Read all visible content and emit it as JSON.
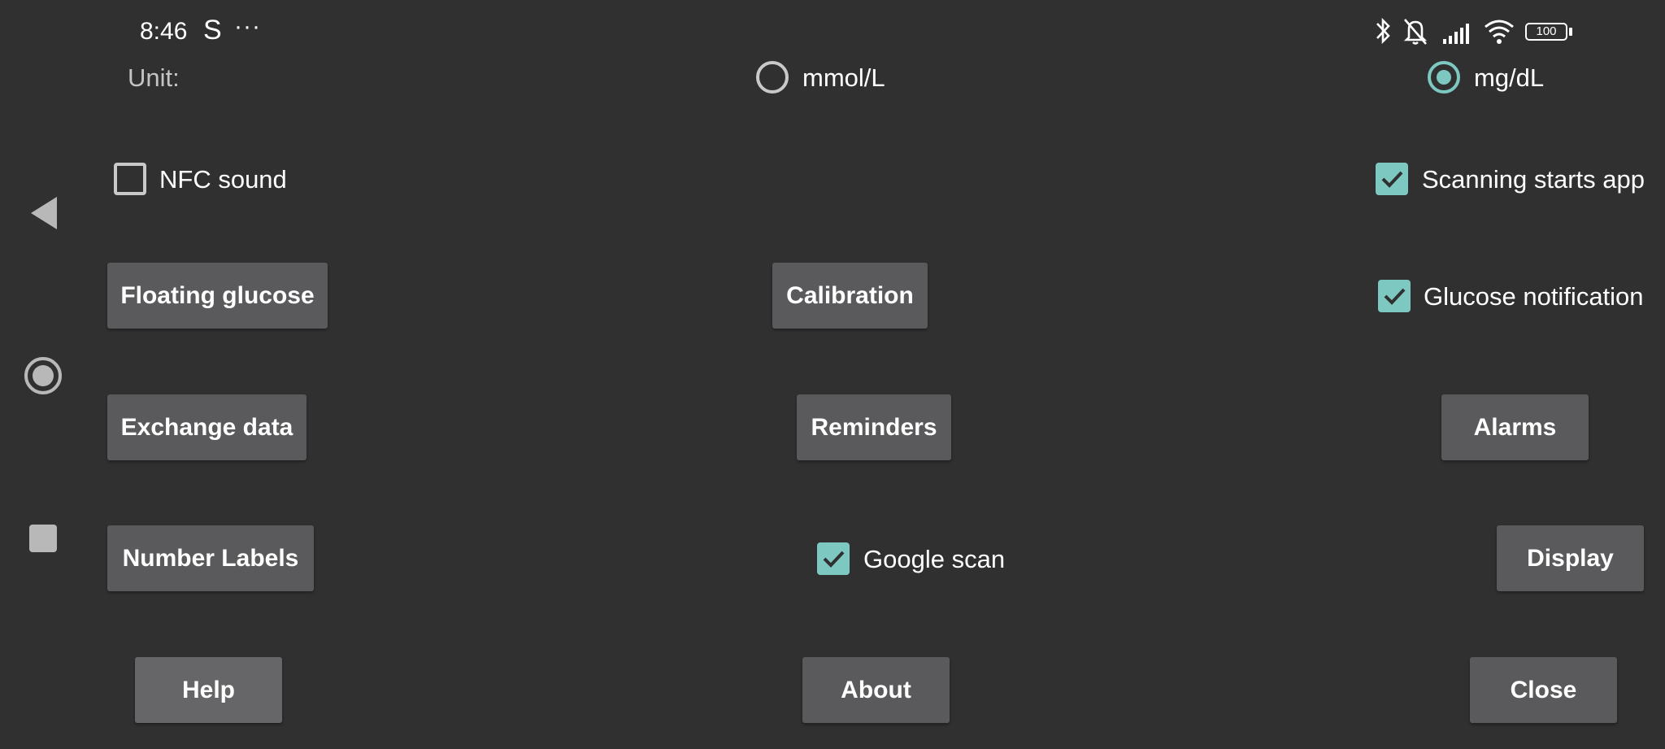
{
  "status_bar": {
    "time": "8:46",
    "app_icon_letter": "S",
    "overflow": "···",
    "battery": "100",
    "icons": [
      "bluetooth-icon",
      "silent-bell-icon",
      "signal-icon",
      "wifi-icon",
      "battery-icon"
    ]
  },
  "unit": {
    "label": "Unit:",
    "options": [
      {
        "label": "mmol/L",
        "selected": false
      },
      {
        "label": "mg/dL",
        "selected": true
      }
    ]
  },
  "checkboxes": {
    "nfc_sound": {
      "label": "NFC sound",
      "checked": false
    },
    "scanning_starts_app": {
      "label": "Scanning starts app",
      "checked": true
    },
    "glucose_notification": {
      "label": "Glucose notification",
      "checked": true
    },
    "google_scan": {
      "label": "Google scan",
      "checked": true
    }
  },
  "buttons": {
    "floating_glucose": "Floating glucose",
    "calibration": "Calibration",
    "exchange_data": "Exchange data",
    "reminders": "Reminders",
    "alarms": "Alarms",
    "number_labels": "Number Labels",
    "display": "Display",
    "help": "Help",
    "about": "About",
    "close": "Close"
  },
  "colors": {
    "background": "#303030",
    "button": "#5a5a5c",
    "accent": "#7ec8c2"
  }
}
